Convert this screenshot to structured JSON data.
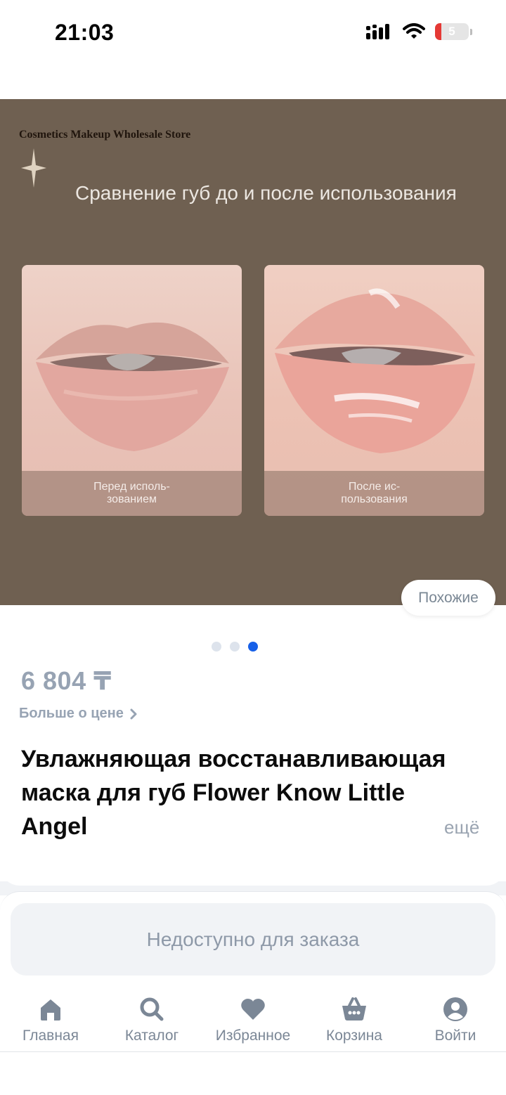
{
  "status_bar": {
    "time": "21:03",
    "battery": "5"
  },
  "product_image": {
    "store_name": "Cosmetics Makeup Wholesale Store",
    "heading": "Сравнение губ до и после использования",
    "before_caption": "Перед исполь- зованием",
    "after_caption": "После ис- пользования"
  },
  "similar_button": "Похожие",
  "gallery": {
    "count": 3,
    "active": 3
  },
  "price": {
    "value": "6 804 ₸",
    "more_label": "Больше о цене"
  },
  "product": {
    "title": "Увлажняющая восстанавливающая маска для губ Flower Know Little Angel",
    "more_label": "ещё"
  },
  "order_button": "Недоступно для заказа",
  "tabs": [
    {
      "label": "Главная",
      "icon": "home-icon"
    },
    {
      "label": "Каталог",
      "icon": "search-icon"
    },
    {
      "label": "Избранное",
      "icon": "heart-icon"
    },
    {
      "label": "Корзина",
      "icon": "basket-icon"
    },
    {
      "label": "Войти",
      "icon": "profile-icon"
    }
  ],
  "colors": {
    "accent": "#1760e8",
    "muted_text": "#97a3b3",
    "image_background": "#6f6051"
  }
}
